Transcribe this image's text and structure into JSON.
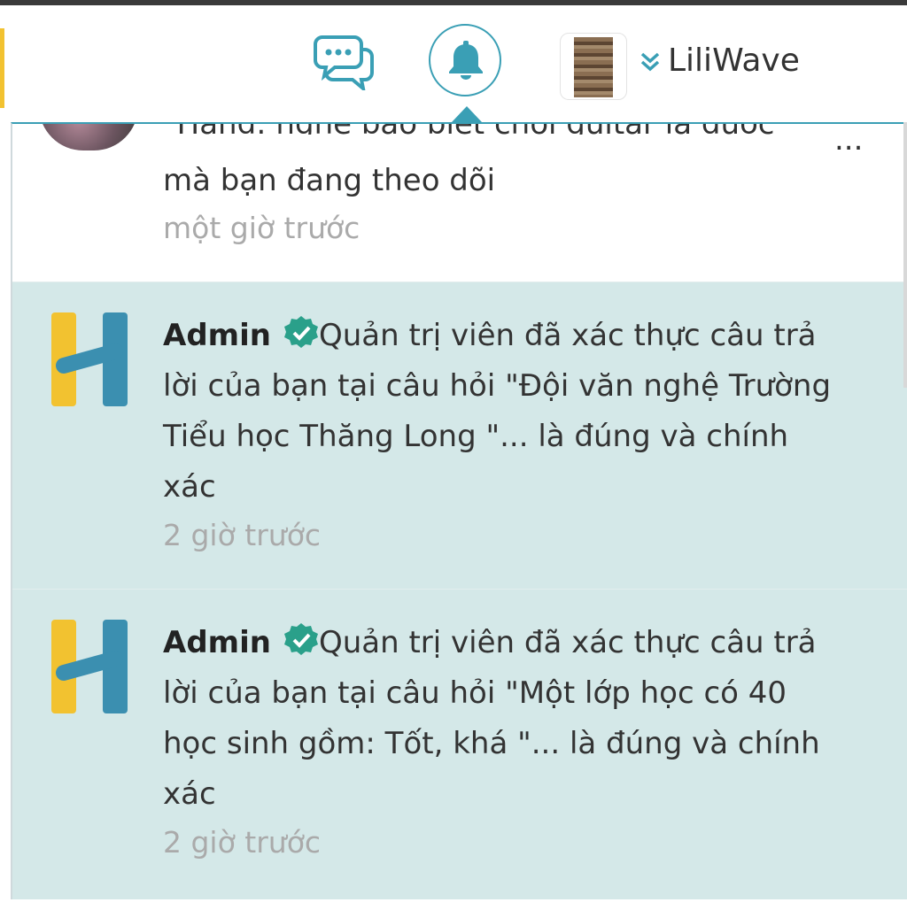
{
  "header": {
    "username": "LiliWave",
    "icons": {
      "chat": "chat-bubbles-icon",
      "bell": "bell-icon",
      "dropdown": "double-chevron-down-icon"
    }
  },
  "colors": {
    "accent": "#3a9fb5",
    "unread_bg": "#d4e8e8",
    "verified": "#2aa08a",
    "logo_yellow": "#f2c230",
    "logo_blue": "#3b8fb0"
  },
  "notifications": [
    {
      "text_top": "\"Hand: nghe bảo biết chơi guitar là được\"",
      "ellipsis": "...",
      "text": "mà bạn đang theo dõi",
      "time": "một giờ trước"
    },
    {
      "sender": "Admin",
      "line1": "Quản trị viên đã xác thực câu trả",
      "line2": "lời của bạn tại câu hỏi \"Đội văn nghệ Trường",
      "line3": "Tiểu học Thăng Long  \"... là đúng và chính",
      "line4": "xác",
      "time": "2 giờ trước"
    },
    {
      "sender": "Admin",
      "line1": "Quản trị viên đã xác thực câu trả",
      "line2": "lời của bạn tại câu hỏi \"Một lớp học có 40",
      "line3": "học sinh gồm: Tốt, khá \"... là đúng và chính",
      "line4": "xác",
      "time": "2 giờ trước"
    }
  ]
}
